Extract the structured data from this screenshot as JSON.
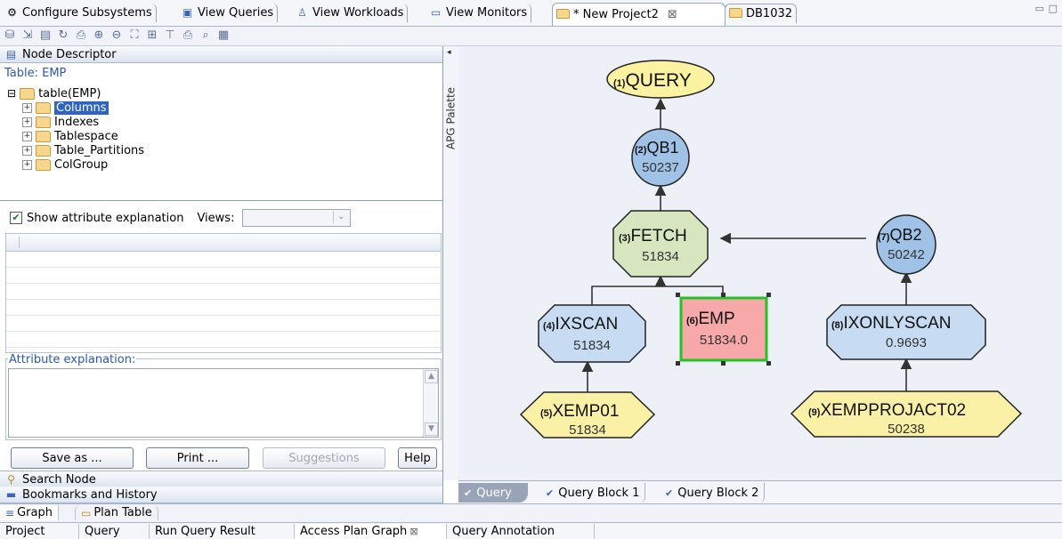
{
  "top_tabs": [
    {
      "label": "Configure Subsystems",
      "icon": "subsystems-icon"
    },
    {
      "label": "View Queries",
      "icon": "queries-icon"
    },
    {
      "label": "View Workloads",
      "icon": "workloads-icon"
    },
    {
      "label": "View Monitors",
      "icon": "monitor-icon"
    },
    {
      "label": "* New Project2",
      "icon": "folder-icon",
      "close": "⊠"
    },
    {
      "label": "DB1032",
      "icon": "folder-icon"
    }
  ],
  "node_descriptor": {
    "title": "Node Descriptor",
    "table_label": "Table: EMP",
    "tree": {
      "root": "table(EMP)",
      "children": [
        "Columns",
        "Indexes",
        "Tablespace",
        "Table_Partitions",
        "ColGroup"
      ],
      "selected": "Columns"
    },
    "show_attr_label": "Show attribute explanation",
    "views_label": "Views:",
    "attr_explanation_label": "Attribute explanation:",
    "buttons": {
      "save": "Save as ...",
      "print": "Print ...",
      "suggestions": "Suggestions",
      "help": "Help"
    },
    "search_node": "Search Node",
    "bookmarks": "Bookmarks and History"
  },
  "palette_label": "APG Palette",
  "graph": {
    "nodes": [
      {
        "num": "(1)",
        "name": "QUERY",
        "value": ""
      },
      {
        "num": "(2)",
        "name": "QB1",
        "value": "50237"
      },
      {
        "num": "(3)",
        "name": "FETCH",
        "value": "51834"
      },
      {
        "num": "(4)",
        "name": "IXSCAN",
        "value": "51834"
      },
      {
        "num": "(5)",
        "name": "XEMP01",
        "value": "51834"
      },
      {
        "num": "(6)",
        "name": "EMP",
        "value": "51834.0"
      },
      {
        "num": "(7)",
        "name": "QB2",
        "value": "50242"
      },
      {
        "num": "(8)",
        "name": "IXONLYSCAN",
        "value": "0.9693"
      },
      {
        "num": "(9)",
        "name": "XEMPPROJACT02",
        "value": "50238"
      }
    ],
    "colors": {
      "query": "#fbf3a0",
      "qb": "#9fc2e6",
      "fetch": "#d6e7c0",
      "scan": "#c7dcf2",
      "index": "#fbf1a6",
      "table": "#f7a8a8",
      "table_border": "#22c322",
      "background": "#eef0f8"
    }
  },
  "graph_tabs": [
    {
      "label": "Query"
    },
    {
      "label": "Query Block 1"
    },
    {
      "label": "Query Block 2"
    }
  ],
  "view_tabs": [
    {
      "label": "Graph"
    },
    {
      "label": "Plan Table"
    }
  ],
  "bottom_tabs": [
    "Project",
    "Query",
    "Run Query Result",
    "Access Plan Graph",
    "Query Annotation"
  ],
  "bottom_active_close": "⊠"
}
